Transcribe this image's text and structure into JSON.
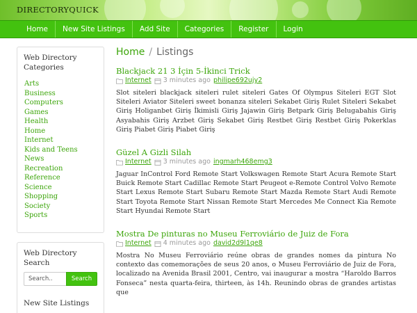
{
  "site": {
    "title": "DIRECTORYQUICK"
  },
  "nav": {
    "items": [
      {
        "label": "Home"
      },
      {
        "label": "New Site Listings"
      },
      {
        "label": "Add Site"
      },
      {
        "label": "Categories"
      },
      {
        "label": "Register"
      },
      {
        "label": "Login"
      }
    ]
  },
  "breadcrumb": {
    "home": "Home",
    "separator": "/",
    "current": "Listings"
  },
  "sidebar": {
    "categories_title": "Web Directory Categories",
    "categories": [
      "Arts",
      "Business",
      "Computers",
      "Games",
      "Health",
      "Home",
      "Internet",
      "Kids and Teens",
      "News",
      "Recreation",
      "Reference",
      "Science",
      "Shopping",
      "Society",
      "Sports"
    ],
    "search_title": "Web Directory Search",
    "search_placeholder": "Search..",
    "search_button": "Search",
    "new_listings_title": "New Site Listings"
  },
  "listings": [
    {
      "title": "Blackjack 21 3 İçin 5-İkinci Trick",
      "category": "Internet",
      "time": "3 minutes ago",
      "user": "philipe692ujy2",
      "description": "Slot siteleri blackjack siteleri rulet siteleri Gates Of Olympus Siteleri EGT Slot Siteleri Aviator Siteleri sweet bonanza siteleri Sekabet Giriş Rulet Siteleri Sekabet Giriş Holiganbet Giriş İkimisli Giriş Jajawin Giriş Betpark Giriş Belugabahis Giriş Asyabahis Giriş Arzbet Giriş Sekabet Giriş Restbet Giriş Restbet Giriş Pokerklas Giriş Piabet Giriş Piabet Giriş"
    },
    {
      "title": "Güzel A Gizli Silah",
      "category": "Internet",
      "time": "3 minutes ago",
      "user": "ingmarh468emg3",
      "description": "Jaguar InControl Ford Remote Start Volkswagen Remote Start Acura Remote Start Buick Remote Start Cadillac Remote Start Peugeot e-Remote Control Volvo Remote Start Lexus Remote Start Subaru Remote Start Mazda Remote Start Audi Remote Start Toyota Remote Start Nissan Remote Start Mercedes Me Connect Kia Remote Start Hyundai Remote Start"
    },
    {
      "title": "Mostra De pinturas no Museu Ferroviário de Juiz de Fora",
      "category": "Internet",
      "time": "4 minutes ago",
      "user": "david2d9l1qe8",
      "description": "Mostra No Museu Ferroviário reúne obras de grandes nomes da pintura No contexto das comemorações de seus 20 anos, o Museu Ferroviário de Juiz de Fora, localizado na Avenida Brasil 2001, Centro, vai inaugurar a mostra “Haroldo Barros Fonseca” nesta quarta-feira, thirteen, às 14h. Reunindo obras de grandes artistas que"
    }
  ]
}
